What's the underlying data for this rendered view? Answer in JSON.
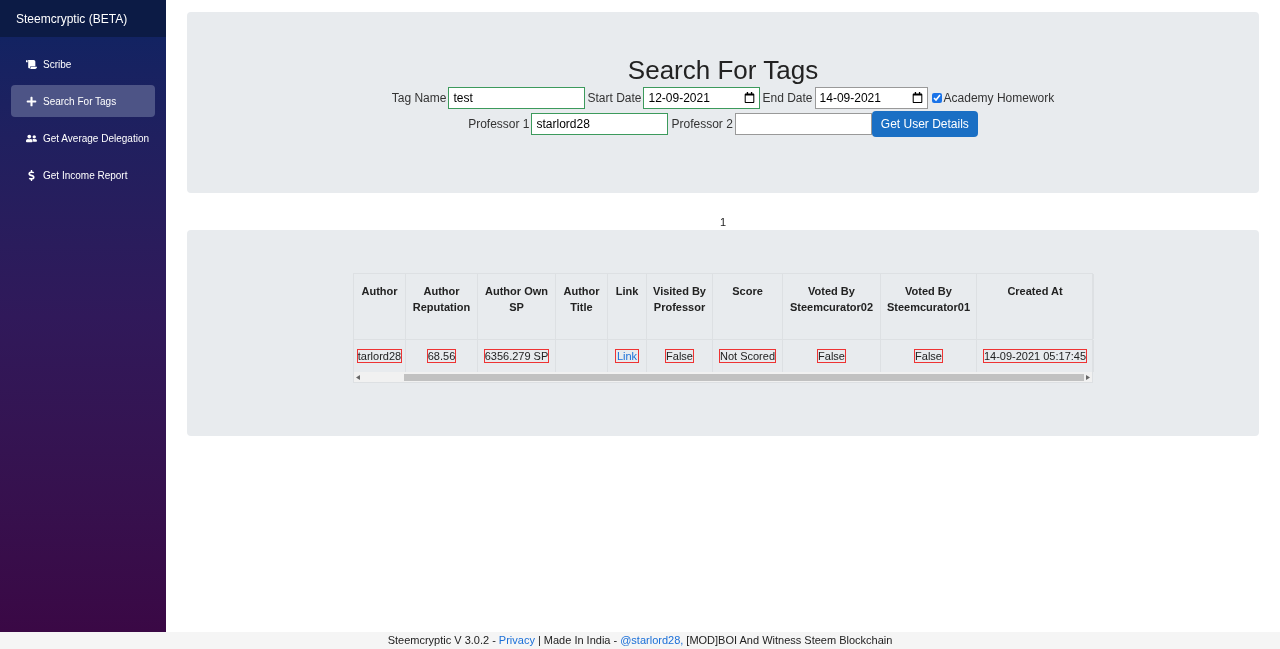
{
  "sidebar": {
    "title": "Steemcryptic (BETA)",
    "items": [
      {
        "label": "Scribe",
        "selected": false
      },
      {
        "label": "Search For Tags",
        "selected": true
      },
      {
        "label": "Get Average Delegation",
        "selected": false
      },
      {
        "label": "Get Income Report",
        "selected": false
      }
    ]
  },
  "form": {
    "title": "Search For Tags",
    "tag_name": {
      "label": "Tag Name",
      "value": "test"
    },
    "start_date": {
      "label": "Start Date",
      "value": "12-09-2021"
    },
    "end_date": {
      "label": "End Date",
      "value": "14-09-2021"
    },
    "academy_homework": {
      "label": "Academy Homework",
      "checked": true
    },
    "professor_1": {
      "label": "Professor 1",
      "value": "starlord28"
    },
    "professor_2": {
      "label": "Professor 2"
    },
    "button": "Get User Details"
  },
  "page_number": "1",
  "table": {
    "columns": [
      "Author",
      "Author Reputation",
      "Author Own SP",
      "Author Title",
      "Link",
      "Visited By Professor",
      "Score",
      "Voted By Steemcurator02",
      "Voted By Steemcurator01",
      "Created At"
    ],
    "rows": [
      [
        {
          "text": "tarlord28",
          "kind": "text"
        },
        {
          "text": "68.56",
          "kind": "text"
        },
        {
          "text": "6356.279 SP",
          "kind": "text"
        },
        {
          "text": "",
          "kind": "empty"
        },
        {
          "text": "Link",
          "kind": "link"
        },
        {
          "text": "False",
          "kind": "text"
        },
        {
          "text": "Not Scored",
          "kind": "text"
        },
        {
          "text": "False",
          "kind": "text"
        },
        {
          "text": "False",
          "kind": "text"
        },
        {
          "text": "14-09-2021 05:17:45",
          "kind": "text"
        }
      ]
    ]
  },
  "footer": [
    {
      "text": "Steemcryptic V 3.0.2 -",
      "kind": "text"
    },
    {
      "text": "Privacy",
      "kind": "link"
    },
    {
      "text": "| Made In India -",
      "kind": "text"
    },
    {
      "text": "@starlord28,",
      "kind": "link"
    },
    {
      "text": "[MOD]BOI And Witness Steem Blockchain",
      "kind": "text"
    }
  ]
}
